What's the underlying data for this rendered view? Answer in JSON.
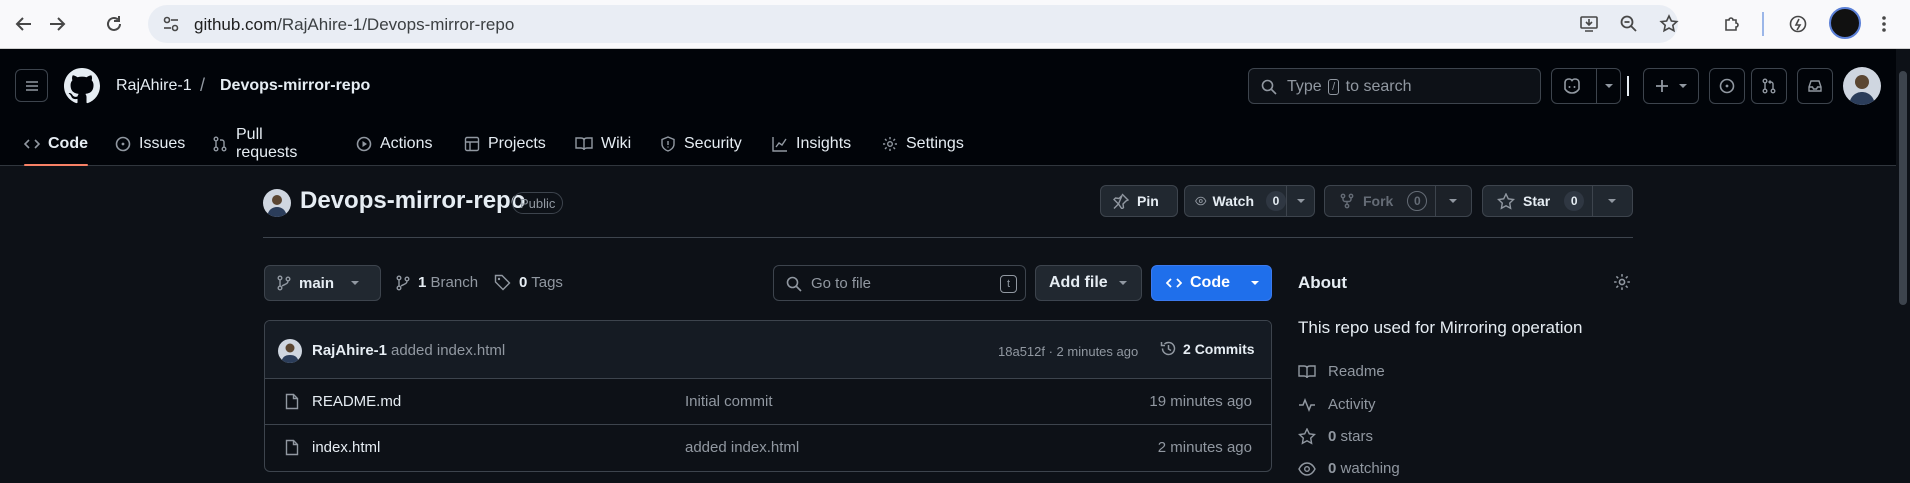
{
  "browser": {
    "url_host": "github.com",
    "url_path": "/RajAhire-1/Devops-mirror-repo"
  },
  "header": {
    "owner": "RajAhire-1",
    "separator": "/",
    "repo": "Devops-mirror-repo",
    "search": {
      "prefix": "Type",
      "key": "/",
      "suffix": "to search"
    }
  },
  "tabs": [
    {
      "label": "Code",
      "icon": "code-icon"
    },
    {
      "label": "Issues",
      "icon": "issue-opened-icon"
    },
    {
      "label": "Pull requests",
      "icon": "git-pull-request-icon"
    },
    {
      "label": "Actions",
      "icon": "play-icon"
    },
    {
      "label": "Projects",
      "icon": "table-icon"
    },
    {
      "label": "Wiki",
      "icon": "book-icon"
    },
    {
      "label": "Security",
      "icon": "shield-icon"
    },
    {
      "label": "Insights",
      "icon": "graph-icon"
    },
    {
      "label": "Settings",
      "icon": "gear-icon"
    }
  ],
  "repo": {
    "title": "Devops-mirror-repo",
    "visibility": "Public",
    "pin_label": "Pin",
    "watch_label": "Watch",
    "watch_count": "0",
    "fork_label": "Fork",
    "fork_count": "0",
    "star_label": "Star",
    "star_count": "0"
  },
  "controls": {
    "branch": "main",
    "branch_count": "1",
    "branch_label": "Branch",
    "tag_count": "0",
    "tag_label": "Tags",
    "go_to_file": "Go to file",
    "go_to_file_key": "t",
    "add_file": "Add file",
    "code": "Code"
  },
  "latest_commit": {
    "author": "RajAhire-1",
    "message": "added index.html",
    "sha_time": "18a512f · 2 minutes ago",
    "commits_count": "2",
    "commits_label": "Commits"
  },
  "files": [
    {
      "name": "README.md",
      "message": "Initial commit",
      "time": "19 minutes ago"
    },
    {
      "name": "index.html",
      "message": "added index.html",
      "time": "2 minutes ago"
    }
  ],
  "about": {
    "heading": "About",
    "description": "This repo used for Mirroring operation",
    "readme": "Readme",
    "activity": "Activity",
    "stars_count": "0",
    "stars_label": "stars",
    "watching_count": "0",
    "watching_label": "watching"
  },
  "colors": {
    "background": "#0d1117",
    "header_bg": "#010409",
    "accent_tab": "#f78166",
    "primary_button": "#1f6feb"
  }
}
